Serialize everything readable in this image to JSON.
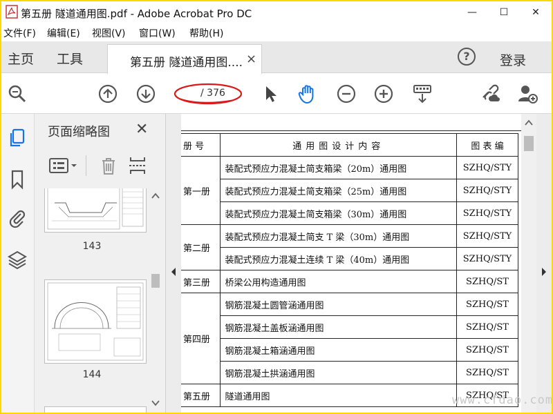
{
  "window": {
    "title": "第五册 隧道通用图.pdf - Adobe Acrobat Pro DC",
    "minimize": "—",
    "maximize": "☐",
    "close": "✕"
  },
  "menu": [
    "文件(F)",
    "编辑(E)",
    "视图(V)",
    "窗口(W)",
    "帮助(H)"
  ],
  "tabs": {
    "home": "主页",
    "tools": "工具",
    "document": "第五册 隧道通用图....",
    "document_close": "×",
    "help": "?",
    "login": "登录"
  },
  "toolbar": {
    "page_current": "",
    "page_total": "/ 376",
    "highlight_color": "#d91a1a"
  },
  "sidebar": {
    "title": "页面缩略图",
    "close": "✕",
    "thumbnails": [
      {
        "label": "143"
      },
      {
        "label": "144"
      }
    ]
  },
  "document": {
    "header": {
      "vol": "册  号",
      "desc": "通用图设计内容",
      "code": "图 表 编"
    },
    "rows": [
      {
        "vol": "第一册",
        "desc": "装配式预应力混凝土简支箱梁（20m）通用图",
        "code": "SZHQ/STY"
      },
      {
        "vol": "",
        "desc": "装配式预应力混凝土简支箱梁（25m）通用图",
        "code": "SZHQ/STY"
      },
      {
        "vol": "",
        "desc": "装配式预应力混凝土简支箱梁（30m）通用图",
        "code": "SZHQ/STY"
      },
      {
        "vol": "第二册",
        "desc": "装配式预应力混凝土简支 T 梁（30m）通用图",
        "code": "SZHQ/STY"
      },
      {
        "vol": "",
        "desc": "装配式预应力混凝土连续 T 梁（40m）通用图",
        "code": "SZHQ/STY"
      },
      {
        "vol": "第三册",
        "desc": "桥梁公用构造通用图",
        "code": "SZHQ/ST"
      },
      {
        "vol": "第四册",
        "desc": "钢筋混凝土圆管涵通用图",
        "code": "SZHQ/ST"
      },
      {
        "vol": "",
        "desc": "钢筋混凝土盖板涵通用图",
        "code": "SZHQ/ST"
      },
      {
        "vol": "",
        "desc": "钢筋混凝土箱涵通用图",
        "code": "SZHQ/ST"
      },
      {
        "vol": "",
        "desc": "钢筋混凝土拱涵通用图",
        "code": "SZHQ/ST"
      },
      {
        "vol": "第五册",
        "desc": "隧道通用图",
        "code": "SZHQ/ST"
      }
    ]
  },
  "watermark": "www.cfdao.com",
  "colors": {
    "accent_blue": "#1473e6",
    "frame": "#ffd800"
  }
}
